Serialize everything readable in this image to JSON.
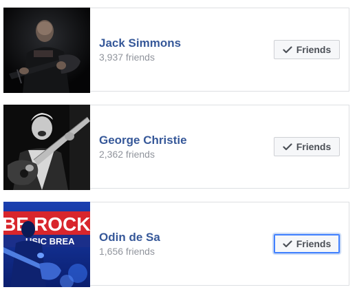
{
  "friends": [
    {
      "name": "Jack Simmons",
      "friend_count": "3,937 friends",
      "button_label": "Friends",
      "button_icon": "check-icon",
      "photo_theme": "dark-guitarist"
    },
    {
      "name": "George Christie",
      "friend_count": "2,362 friends",
      "button_label": "Friends",
      "button_icon": "check-icon",
      "photo_theme": "bw-guitarist"
    },
    {
      "name": "Odin de Sa",
      "friend_count": "1,656 friends",
      "button_label": "Friends",
      "button_icon": "check-icon",
      "photo_theme": "blue-stage-guitarist",
      "photo_text": [
        "BE",
        "ROCK",
        "USIC BREA"
      ]
    }
  ],
  "colors": {
    "name_link": "#365899",
    "count_text": "#90949c",
    "button_bg": "#f6f7f9",
    "button_border": "#ced0d4",
    "focus_ring": "#4080ff",
    "card_border": "#dddfe2"
  }
}
